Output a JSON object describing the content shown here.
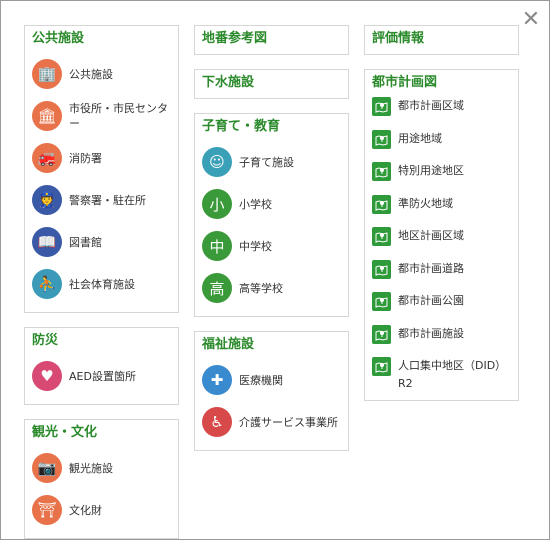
{
  "close_label": "✕",
  "columns": {
    "col1": [
      {
        "title": "公共施設",
        "items": [
          {
            "label": "公共施設",
            "icon": "public-facility-icon",
            "color": "#e8734a"
          },
          {
            "label": "市役所・市民センター",
            "icon": "city-hall-icon",
            "color": "#e8734a"
          },
          {
            "label": "消防署",
            "icon": "fire-station-icon",
            "color": "#e8734a"
          },
          {
            "label": "警察署・駐在所",
            "icon": "police-icon",
            "color": "#3a5aa8"
          },
          {
            "label": "図書館",
            "icon": "library-icon",
            "color": "#3a5aa8"
          },
          {
            "label": "社会体育施設",
            "icon": "sports-facility-icon",
            "color": "#3a9ab8"
          }
        ]
      },
      {
        "title": "防災",
        "items": [
          {
            "label": "AED設置箇所",
            "icon": "aed-icon",
            "color": "#d84a74"
          }
        ]
      },
      {
        "title": "観光・文化",
        "items": [
          {
            "label": "観光施設",
            "icon": "tourism-icon",
            "color": "#e8734a"
          },
          {
            "label": "文化財",
            "icon": "cultural-property-icon",
            "color": "#e8734a"
          }
        ]
      }
    ],
    "col2": [
      {
        "title": "地番参考図",
        "items": []
      },
      {
        "title": "下水施設",
        "items": []
      },
      {
        "title": "子育て・教育",
        "items": [
          {
            "label": "子育て施設",
            "icon": "childcare-icon",
            "color": "#3aa0b8"
          },
          {
            "label": "小学校",
            "icon": "elementary-school-icon",
            "color": "#3a9a3a"
          },
          {
            "label": "中学校",
            "icon": "junior-high-school-icon",
            "color": "#3a9a3a"
          },
          {
            "label": "高等学校",
            "icon": "high-school-icon",
            "color": "#3a9a3a"
          }
        ]
      },
      {
        "title": "福祉施設",
        "items": [
          {
            "label": "医療機関",
            "icon": "medical-icon",
            "color": "#3a8ad0"
          },
          {
            "label": "介護サービス事業所",
            "icon": "nursing-care-icon",
            "color": "#d84a4a"
          }
        ]
      }
    ],
    "col3": [
      {
        "title": "評価情報",
        "items": []
      },
      {
        "title": "都市計画図",
        "items": [
          {
            "label": "都市計画区域"
          },
          {
            "label": "用途地域"
          },
          {
            "label": "特別用途地区"
          },
          {
            "label": "準防火地域"
          },
          {
            "label": "地区計画区域"
          },
          {
            "label": "都市計画道路"
          },
          {
            "label": "都市計画公園"
          },
          {
            "label": "都市計画施設"
          },
          {
            "label": "人口集中地区（DID）R2"
          }
        ]
      }
    ]
  }
}
